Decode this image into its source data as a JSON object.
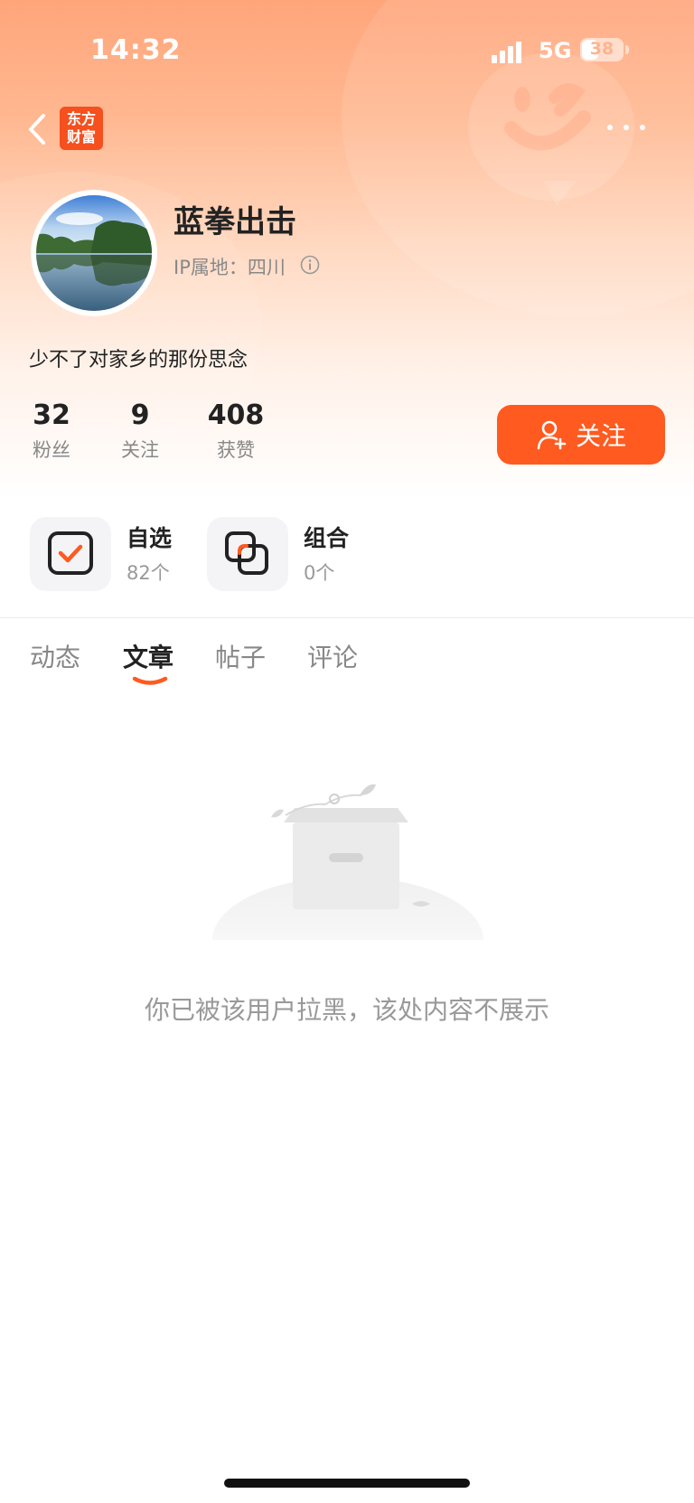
{
  "status_bar": {
    "time": "14:32",
    "network": "5G",
    "battery": "38"
  },
  "header": {
    "app_logo_line1": "东方",
    "app_logo_line2": "财富"
  },
  "profile": {
    "username": "蓝拳出击",
    "ip_location": "IP属地：四川",
    "bio": "少不了对家乡的那份思念"
  },
  "stats": [
    {
      "value": "32",
      "label": "粉丝"
    },
    {
      "value": "9",
      "label": "关注"
    },
    {
      "value": "408",
      "label": "获赞"
    }
  ],
  "follow_button": {
    "label": "关注"
  },
  "tiles": [
    {
      "title": "自选",
      "subtitle": "82个",
      "icon": "checkbox-icon"
    },
    {
      "title": "组合",
      "subtitle": "0个",
      "icon": "overlap-squares-icon"
    }
  ],
  "tabs": [
    {
      "label": "动态",
      "active": false
    },
    {
      "label": "文章",
      "active": true
    },
    {
      "label": "帖子",
      "active": false
    },
    {
      "label": "评论",
      "active": false
    }
  ],
  "empty_state": {
    "message": "你已被该用户拉黑，该处内容不展示"
  },
  "colors": {
    "accent": "#ff5a1f",
    "hero_top": "#ffa57a"
  }
}
